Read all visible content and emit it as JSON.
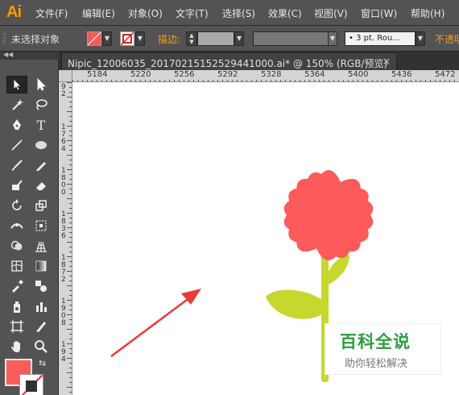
{
  "app": {
    "logo": "Ai"
  },
  "menu": {
    "items": [
      "文件(F)",
      "编辑(E)",
      "对象(O)",
      "文字(T)",
      "选择(S)",
      "效果(C)",
      "视图(V)",
      "窗口(W)",
      "帮助(H)"
    ]
  },
  "control_bar": {
    "selection_status": "未选择对象",
    "stroke_label": "描边:",
    "stroke_profile": "• 3 pt. Rou...",
    "opacity_label": "不透明",
    "fill_color": "#f85a5a"
  },
  "document_tab": {
    "title": "Nipic_12006035_20170215152529441000.ai* @ 150% (RGB/预览)",
    "close": "×"
  },
  "ruler": {
    "horizontal_labels": [
      "5184",
      "5220",
      "5256",
      "5292",
      "5328",
      "5364",
      "5400",
      "5436",
      "5472"
    ],
    "vertical_labels": [
      "92",
      "1764",
      "1800",
      "1836",
      "1872",
      "1908",
      "194"
    ]
  },
  "toolbox": {
    "fill_color": "#fd5a5a",
    "stroke_color": "#ffffff"
  },
  "artwork": {
    "petal_color": "#fd5a5a",
    "stem_color": "#c6d82d",
    "arrow_color": "#e83a3a"
  },
  "watermark": {
    "title": "百科全说",
    "subtitle": "助你轻松解决"
  }
}
